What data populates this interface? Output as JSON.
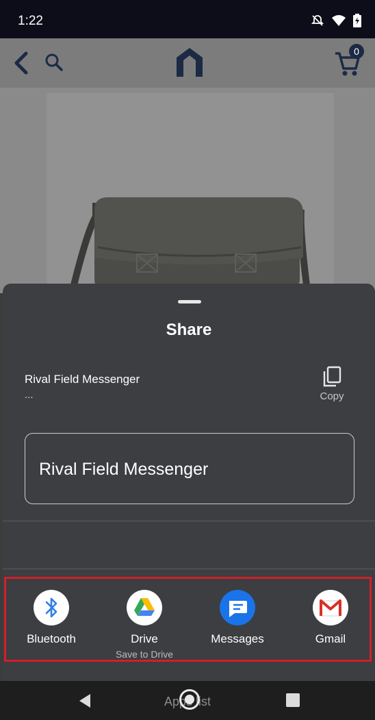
{
  "status_bar": {
    "time": "1:22",
    "icons": [
      "alarm-off-icon",
      "wifi-icon",
      "battery-charging-icon"
    ]
  },
  "app_bar": {
    "icons": [
      "back-icon",
      "search-icon",
      "logo-icon",
      "cart-icon"
    ],
    "cart_count": "0"
  },
  "product": {
    "image": "messenger-bag-image"
  },
  "share_sheet": {
    "title": "Share",
    "preview_title": "Rival Field Messenger",
    "preview_subtitle": "...",
    "copy_label": "Copy",
    "text_content": "Rival Field Messenger"
  },
  "share_targets": [
    {
      "label": "Bluetooth",
      "sub": "",
      "icon": "bluetooth-icon"
    },
    {
      "label": "Drive",
      "sub": "Save to Drive",
      "icon": "drive-icon"
    },
    {
      "label": "Messages",
      "sub": "",
      "icon": "messages-icon"
    },
    {
      "label": "Gmail",
      "sub": "",
      "icon": "gmail-icon"
    }
  ],
  "nav_bar": {
    "overlay_text": "Apps list",
    "icons": [
      "back-triangle-icon",
      "home-circle-icon",
      "recents-square-icon"
    ]
  },
  "colors": {
    "highlight": "#d11f2a",
    "sheet": "#3c3e41",
    "status_bar": "#0d0d1a"
  }
}
